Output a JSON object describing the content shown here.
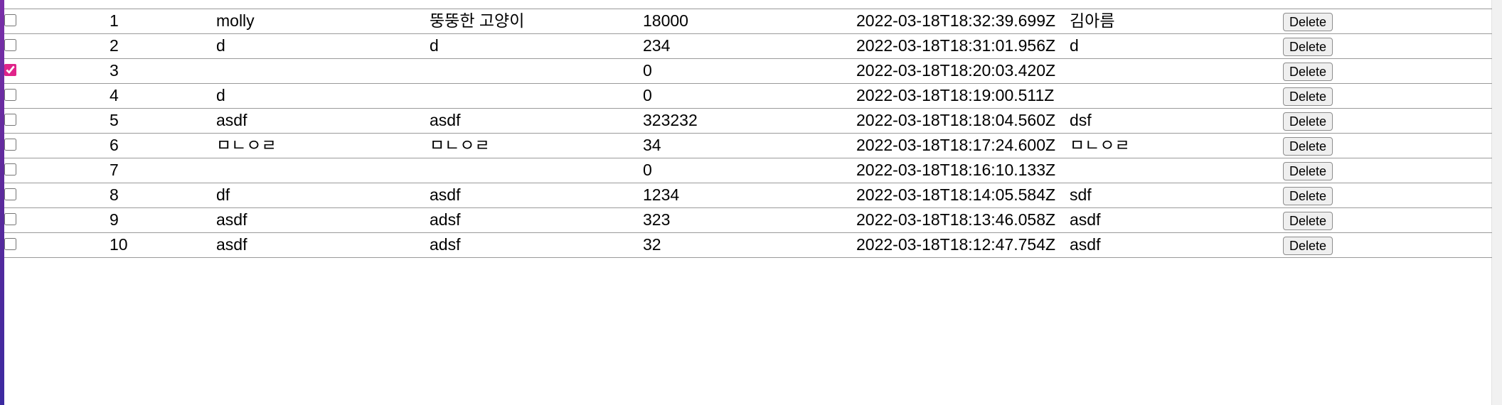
{
  "colors": {
    "checkbox_accent": "#e0248a",
    "row_border": "#9a9a9a",
    "left_strip": "#5e2a9c"
  },
  "rows": [
    {
      "checked": false,
      "id": "1",
      "name": "molly",
      "desc": "뚱뚱한 고양이",
      "price": "18000",
      "date": "2022-03-18T18:32:39.699Z",
      "owner": "김아름",
      "action": "Delete"
    },
    {
      "checked": false,
      "id": "2",
      "name": "d",
      "desc": "d",
      "price": "234",
      "date": "2022-03-18T18:31:01.956Z",
      "owner": "d",
      "action": "Delete"
    },
    {
      "checked": true,
      "id": "3",
      "name": "",
      "desc": "",
      "price": "0",
      "date": "2022-03-18T18:20:03.420Z",
      "owner": "",
      "action": "Delete"
    },
    {
      "checked": false,
      "id": "4",
      "name": "d",
      "desc": "",
      "price": "0",
      "date": "2022-03-18T18:19:00.511Z",
      "owner": "",
      "action": "Delete"
    },
    {
      "checked": false,
      "id": "5",
      "name": "asdf",
      "desc": "asdf",
      "price": "323232",
      "date": "2022-03-18T18:18:04.560Z",
      "owner": "dsf",
      "action": "Delete"
    },
    {
      "checked": false,
      "id": "6",
      "name": "ㅁㄴㅇㄹ",
      "desc": "ㅁㄴㅇㄹ",
      "price": "34",
      "date": "2022-03-18T18:17:24.600Z",
      "owner": "ㅁㄴㅇㄹ",
      "action": "Delete"
    },
    {
      "checked": false,
      "id": "7",
      "name": "",
      "desc": "",
      "price": "0",
      "date": "2022-03-18T18:16:10.133Z",
      "owner": "",
      "action": "Delete"
    },
    {
      "checked": false,
      "id": "8",
      "name": "df",
      "desc": "asdf",
      "price": "1234",
      "date": "2022-03-18T18:14:05.584Z",
      "owner": "sdf",
      "action": "Delete"
    },
    {
      "checked": false,
      "id": "9",
      "name": "asdf",
      "desc": "adsf",
      "price": "323",
      "date": "2022-03-18T18:13:46.058Z",
      "owner": "asdf",
      "action": "Delete"
    },
    {
      "checked": false,
      "id": "10",
      "name": "asdf",
      "desc": "adsf",
      "price": "32",
      "date": "2022-03-18T18:12:47.754Z",
      "owner": "asdf",
      "action": "Delete"
    }
  ]
}
